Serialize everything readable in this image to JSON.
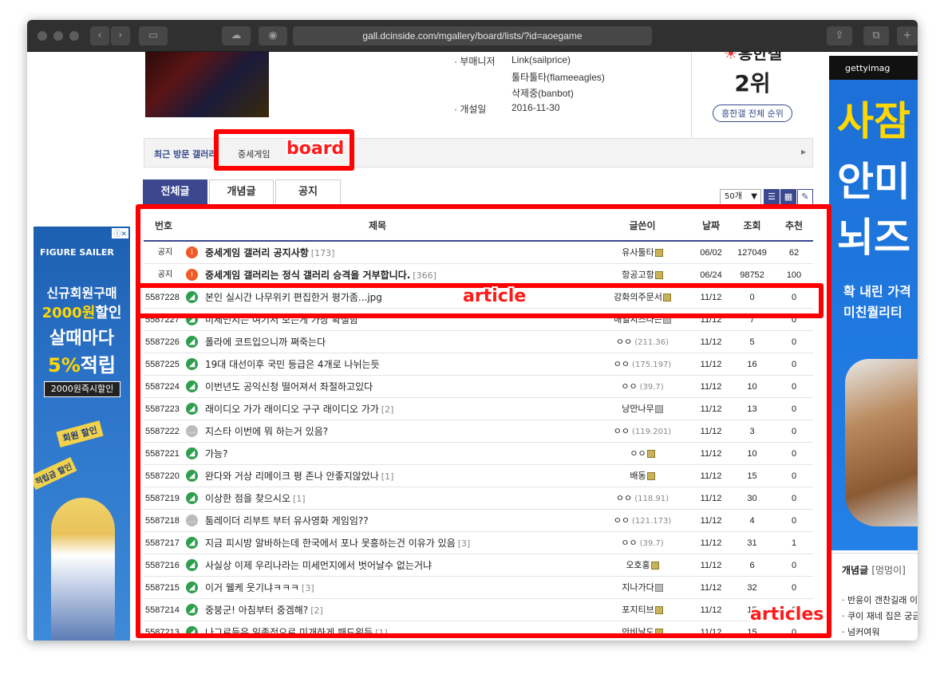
{
  "browser": {
    "url": "gall.dcinside.com/mgallery/board/lists/?id=aoegame"
  },
  "gallery_info": {
    "managers_label": "· 부매니저",
    "managers": [
      "Link(sailprice)",
      "툴타툴타(flameeagles)",
      "삭제중(banbot)"
    ],
    "founded_label": "· 개설일",
    "founded": "2016-11-30"
  },
  "rank": {
    "heading": "흥한갤",
    "value": "2위",
    "button": "흥한갤 전체 순위"
  },
  "recent": {
    "label": "최근 방문 갤러리",
    "item": "중세게임",
    "arrow": "▸"
  },
  "tabs": [
    "전체글",
    "개념글",
    "공지"
  ],
  "list_controls": {
    "per_page": "50개"
  },
  "columns": [
    "번호",
    "제목",
    "글쓴이",
    "날짜",
    "조회",
    "추천"
  ],
  "notices": [
    {
      "num": "공지",
      "title": "중세게임 갤러리 공지사항",
      "comments": "[173]",
      "writer": "유사툴타",
      "date": "06/02",
      "views": "127049",
      "rec": "62"
    },
    {
      "num": "공지",
      "title": "중세게임 갤러리는 정식 갤러리 승격을 거부합니다.",
      "comments": "[366]",
      "writer": "항공고항",
      "date": "06/24",
      "views": "98752",
      "rec": "100"
    }
  ],
  "posts": [
    {
      "num": "5587228",
      "title": "본인 실시간 나무위키 편집한거 평가좀...jpg",
      "comments": "",
      "writer": "강화의주문서",
      "ip": "",
      "date": "11/12",
      "views": "0",
      "rec": "0",
      "icon": "image"
    },
    {
      "num": "5587227",
      "title": "미세먼지는 여기서 보는게 가장 확실함",
      "comments": "",
      "writer": "매일치즈나는",
      "ip": "",
      "date": "11/12",
      "views": "7",
      "rec": "0",
      "icon": "image"
    },
    {
      "num": "5587226",
      "title": "폴라에 코트입으니까 쪄죽는다",
      "comments": "",
      "writer": "ㅇㅇ",
      "ip": "(211.36)",
      "date": "11/12",
      "views": "5",
      "rec": "0",
      "icon": "image"
    },
    {
      "num": "5587225",
      "title": "19대 대선이후 국민 등급은 4개로 나뉘는듯",
      "comments": "",
      "writer": "ㅇㅇ",
      "ip": "(175.197)",
      "date": "11/12",
      "views": "16",
      "rec": "0",
      "icon": "image"
    },
    {
      "num": "5587224",
      "title": "이번년도 공익신청 떨어져서 좌절하고있다",
      "comments": "",
      "writer": "ㅇㅇ",
      "ip": "(39.7)",
      "date": "11/12",
      "views": "10",
      "rec": "0",
      "icon": "image"
    },
    {
      "num": "5587223",
      "title": "래이디오 가가 래이디오 구구 래이디오 가가",
      "comments": "[2]",
      "writer": "낭만나무",
      "ip": "",
      "date": "11/12",
      "views": "13",
      "rec": "0",
      "icon": "image"
    },
    {
      "num": "5587222",
      "title": "지스타 이번에 뭐 하는거 있음?",
      "comments": "",
      "writer": "ㅇㅇ",
      "ip": "(119.201)",
      "date": "11/12",
      "views": "3",
      "rec": "0",
      "icon": "text"
    },
    {
      "num": "5587221",
      "title": "가능?",
      "comments": "",
      "writer": "ㅇㅇ",
      "ip": "",
      "date": "11/12",
      "views": "10",
      "rec": "0",
      "icon": "image"
    },
    {
      "num": "5587220",
      "title": "완다와 거상 리메이크 평 존나 안좋지않았나",
      "comments": "[1]",
      "writer": "배동",
      "ip": "",
      "date": "11/12",
      "views": "15",
      "rec": "0",
      "icon": "image"
    },
    {
      "num": "5587219",
      "title": "이상한 점을 찾으시오",
      "comments": "[1]",
      "writer": "ㅇㅇ",
      "ip": "(118.91)",
      "date": "11/12",
      "views": "30",
      "rec": "0",
      "icon": "image"
    },
    {
      "num": "5587218",
      "title": "툼레이더 리부트 부터 유사영화 게임임??",
      "comments": "",
      "writer": "ㅇㅇ",
      "ip": "(121.173)",
      "date": "11/12",
      "views": "4",
      "rec": "0",
      "icon": "text"
    },
    {
      "num": "5587217",
      "title": "지금 피시방 알바하는데 한국에서 포나 못흥하는건 이유가 있음",
      "comments": "[3]",
      "writer": "ㅇㅇ",
      "ip": "(39.7)",
      "date": "11/12",
      "views": "31",
      "rec": "1",
      "icon": "image"
    },
    {
      "num": "5587216",
      "title": "사실상 이제 우리나라는 미세먼지에서 벗어날수 없는거냐",
      "comments": "",
      "writer": "오호홍",
      "ip": "",
      "date": "11/12",
      "views": "6",
      "rec": "0",
      "icon": "image"
    },
    {
      "num": "5587215",
      "title": "이거 웰케 웃기냐ㅋㅋㅋ",
      "comments": "[3]",
      "writer": "지나가다",
      "ip": "",
      "date": "11/12",
      "views": "32",
      "rec": "0",
      "icon": "image"
    },
    {
      "num": "5587214",
      "title": "중붕군! 아침부터 중겜해?",
      "comments": "[2]",
      "writer": "포지티브",
      "ip": "",
      "date": "11/12",
      "views": "15",
      "rec": "0",
      "icon": "image"
    },
    {
      "num": "5587213",
      "title": "나그로들은 일종적으로 미개하게 패드위든",
      "comments": "[1]",
      "writer": "안비날도",
      "ip": "",
      "date": "11/12",
      "views": "15",
      "rec": "0",
      "icon": "image"
    }
  ],
  "ads": {
    "left": {
      "brand": "FIGURE SAILER",
      "line1": "신규회원구매",
      "line2a": "2000원",
      "line2b": "할인",
      "line3": "살때마다",
      "line4a": "5%",
      "line4b": "적립",
      "line5": "2000원즉시할인",
      "tag1": "회원 할인",
      "tag2": "적립금 할인"
    },
    "right": {
      "brand": "gettyimag",
      "big1": "사잠",
      "big2": "안미",
      "big3": "뇌즈",
      "sub1": "확 내린 가격",
      "sub2": "미친퀄리티"
    }
  },
  "concept_box": {
    "title": "개념글",
    "tag": "[멍멍이]",
    "items": [
      "· 반응이 갠찬길래 이",
      "· 쿠이 재네 집은 궁금",
      "· 넘커여워"
    ]
  },
  "annotations": {
    "board": "board",
    "article": "article",
    "articles": "articles"
  },
  "colors": {
    "accent": "#3b4890",
    "highlight": "#ff0000",
    "image_icon": "#2f9e4f",
    "notice_icon": "#f15a24"
  }
}
